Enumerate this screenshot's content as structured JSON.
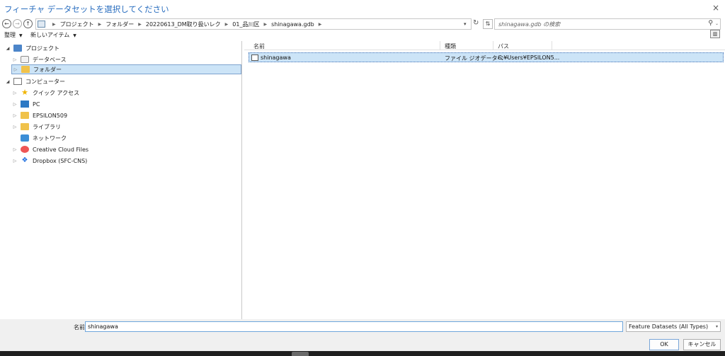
{
  "window": {
    "title": "フィーチャ データセットを選択してください",
    "close_label": "×"
  },
  "address": {
    "breadcrumbs": [
      "プロジェクト",
      "フォルダー",
      "20220613_DM取り扱いレク",
      "01_品川区",
      "shinagawa.gdb"
    ],
    "back_label": "←",
    "forward_label": "→",
    "up_label": "↑",
    "dropdown_label": "▾",
    "refresh_label": "↻",
    "sort_label": "⇅",
    "search_placeholder": "shinagawa.gdb の検索",
    "search_icon": "⚲",
    "search_dropdown": "⌄"
  },
  "toolbar": {
    "organize_label": "整理",
    "new_item_label": "新しいアイテム",
    "dropdown": "▼",
    "view_label": "▥"
  },
  "tree": [
    {
      "label": "プロジェクト",
      "expander": "◢",
      "icon": "project-icon",
      "selected": false
    },
    {
      "label": "データベース",
      "expander": "▷",
      "icon": "database-icon",
      "selected": false
    },
    {
      "label": "フォルダー",
      "expander": "▷",
      "icon": "folder-icon",
      "selected": true
    },
    {
      "label": "コンピューター",
      "expander": "◢",
      "icon": "computer-icon",
      "selected": false
    },
    {
      "label": "クイック アクセス",
      "expander": "▷",
      "icon": "star-icon",
      "selected": false
    },
    {
      "label": "PC",
      "expander": "▷",
      "icon": "pc-icon",
      "selected": false
    },
    {
      "label": "EPSILON509",
      "expander": "▷",
      "icon": "folder-icon",
      "selected": false
    },
    {
      "label": "ライブラリ",
      "expander": "▷",
      "icon": "library-icon",
      "selected": false
    },
    {
      "label": "ネットワーク",
      "expander": "",
      "icon": "network-icon",
      "selected": false
    },
    {
      "label": "Creative Cloud Files",
      "expander": "▷",
      "icon": "creative-cloud-icon",
      "selected": false
    },
    {
      "label": "Dropbox (SFC-CNS)",
      "expander": "▷",
      "icon": "dropbox-icon",
      "selected": false
    }
  ],
  "file_list": {
    "columns": [
      "名前",
      "種類",
      "パス"
    ],
    "rows": [
      {
        "name": "shinagawa",
        "type": "ファイル ジオデータベー",
        "path": "C:¥Users¥EPSILON5..."
      }
    ]
  },
  "bottom": {
    "name_label": "名前",
    "name_value": "shinagawa",
    "type_filter": "Feature Datasets (All Types)",
    "type_dropdown": "▾",
    "ok_label": "OK",
    "cancel_label": "キャンセル"
  }
}
